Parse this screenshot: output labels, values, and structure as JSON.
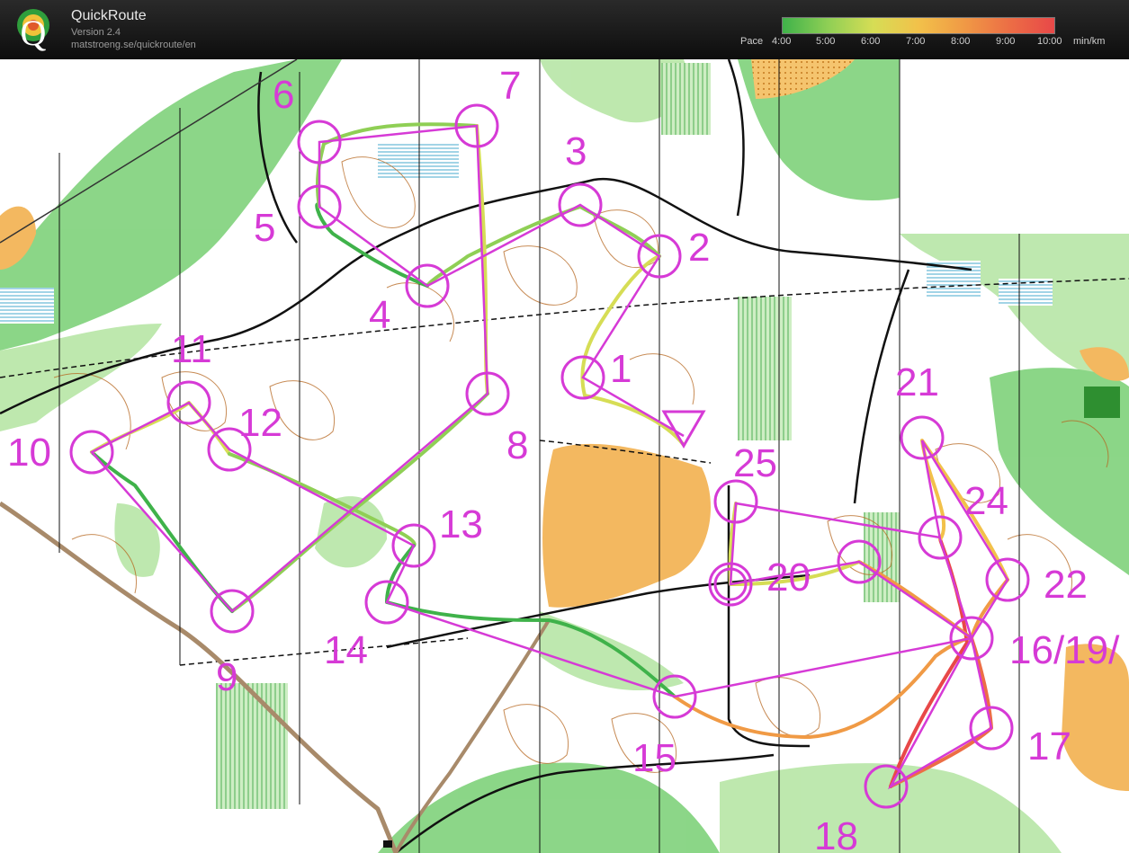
{
  "app": {
    "title": "QuickRoute",
    "version": "Version 2.4",
    "url": "matstroeng.se/quickroute/en",
    "logo_letter": "Q"
  },
  "pace": {
    "label": "Pace",
    "ticks": [
      "4:00",
      "5:00",
      "6:00",
      "7:00",
      "8:00",
      "9:00",
      "10:00"
    ],
    "unit": "min/km",
    "colors": [
      "#3fb24a",
      "#8fcf55",
      "#d6dd55",
      "#f2c14a",
      "#f09a45",
      "#ec6e45",
      "#e84848"
    ]
  },
  "map": {
    "colors": {
      "forest_green": "#7dd37a",
      "light_green": "#b7e6a6",
      "open_yellow": "#f3b860",
      "contour_brown": "#b5651d",
      "course_magenta": "#d63ad6",
      "marsh_blue": "#44aacc",
      "track_black": "#111111"
    },
    "controls": [
      {
        "label": "1"
      },
      {
        "label": "2"
      },
      {
        "label": "3"
      },
      {
        "label": "4"
      },
      {
        "label": "5"
      },
      {
        "label": "6"
      },
      {
        "label": "7"
      },
      {
        "label": "8"
      },
      {
        "label": "9"
      },
      {
        "label": "10"
      },
      {
        "label": "11"
      },
      {
        "label": "12"
      },
      {
        "label": "13"
      },
      {
        "label": "14"
      },
      {
        "label": "15"
      },
      {
        "label": "16/19/"
      },
      {
        "label": "17"
      },
      {
        "label": "18"
      },
      {
        "label": "20"
      },
      {
        "label": "21"
      },
      {
        "label": "22"
      },
      {
        "label": "24"
      },
      {
        "label": "25"
      }
    ]
  }
}
